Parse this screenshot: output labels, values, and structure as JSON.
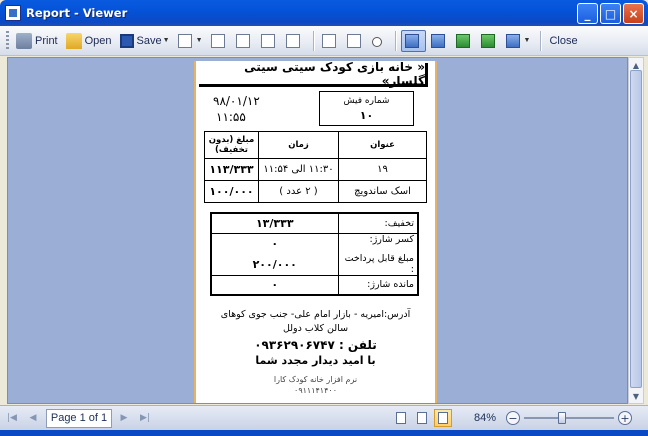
{
  "window": {
    "title": "Report - Viewer",
    "controls": [
      "_",
      "□",
      "×"
    ]
  },
  "toolbar": {
    "print_label": "Print",
    "open_label": "Open",
    "save_label": "Save",
    "close_label": "Close"
  },
  "receipt": {
    "header": "« خانه بازی کودک سیتی سیتی گلسار»",
    "date": "۹۸/۰۱/۱۲",
    "time": "۱۱:۵۵",
    "number_label": "شماره فیش",
    "number_value": "۱۰",
    "items_table": {
      "columns": [
        "عنوان",
        "زمان",
        "مبلغ (بدون تخفیف)"
      ],
      "rows": [
        [
          "۱۹",
          "۱۱:۳۰ الی ۱۱:۵۴",
          "۱۱۳/۳۳۳"
        ],
        [
          "اسک ساندویچ",
          "( ۲ عدد )",
          "۱۰۰/۰۰۰"
        ]
      ]
    },
    "summary": {
      "discount_label": "تخفیف:",
      "discount_value": "۱۳/۳۳۳",
      "charge_deduct_label": "کسر شارژ:",
      "charge_deduct_value": "۰",
      "payable_label": "مبلغ قابل پرداخت :",
      "payable_value": "۲۰۰/۰۰۰",
      "remaining_label": "مانده شارژ:",
      "remaining_value": "۰"
    },
    "footer": {
      "address": "آدرس:امیریه - بازار امام علی- جنب جوی کوهای",
      "line2": "سالن کلاب دولل",
      "phone": "تلفن : ۰۹۳۶۲۹۰۶۷۴۷",
      "line4": "با امید دیدار مجدد شما",
      "software": "نرم افزار خانه کودک کارا",
      "software_phone": "۰۹۱۱۱۴۱۴۰۰"
    }
  },
  "statusbar": {
    "page_label": "Page 1 of 1",
    "zoom_label": "84%",
    "zoom_level_percent": 84
  }
}
